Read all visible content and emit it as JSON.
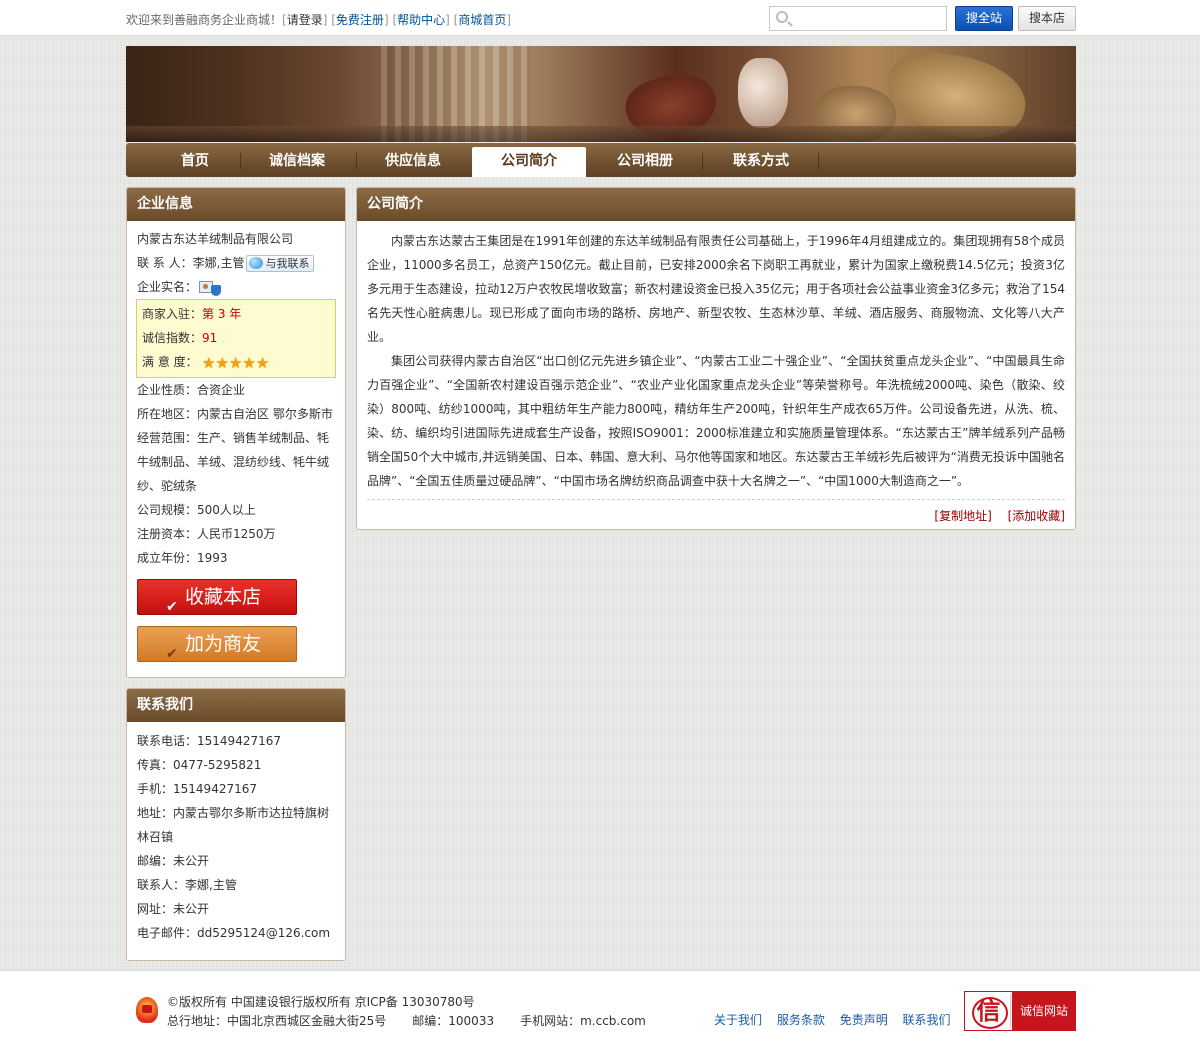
{
  "topbar": {
    "welcome": "欢迎来到善融商务企业商城！",
    "login": "请登录",
    "register": "免费注册",
    "help": "帮助中心",
    "mall_home": "商城首页",
    "search_placeholder": "",
    "search_site": "搜全站",
    "search_shop": "搜本店"
  },
  "nav": {
    "items": [
      "首页",
      "诚信档案",
      "供应信息",
      "公司简介",
      "公司相册",
      "联系方式"
    ],
    "active": "公司简介"
  },
  "enterprise": {
    "heading": "企业信息",
    "company_name": "内蒙古东达羊绒制品有限公司",
    "contact_label": "联 系 人：",
    "contact_person": "李娜,主管",
    "contact_me": "与我联系",
    "realname_label": "企业实名：",
    "credit": {
      "settled_label": "商家入驻：",
      "settled_value": "第 3 年",
      "index_label": "诚信指数：",
      "index_value": "91",
      "satisfaction_label": "满 意 度：",
      "satisfaction_stars": "★★★★★",
      "satisfaction_rating": 5
    },
    "nature_label": "企业性质：",
    "nature": "合资企业",
    "region_label": "所在地区：",
    "region": "内蒙古自治区 鄂尔多斯市",
    "scope_label": "经营范围：",
    "scope": "生产、销售羊绒制品、牦牛绒制品、羊绒、混纺纱线、牦牛绒纱、驼绒条",
    "scale_label": "公司规模：",
    "scale": "500人以上",
    "capital_label": "注册资本：",
    "capital": "人民币1250万",
    "founded_label": "成立年份：",
    "founded": "1993",
    "fav_button": "收藏本店",
    "friend_button": "加为商友"
  },
  "contact": {
    "heading": "联系我们",
    "phone_label": "联系电话：",
    "phone": "15149427167",
    "fax_label": "传真：",
    "fax": "0477-5295821",
    "mobile_label": "手机：",
    "mobile": "15149427167",
    "address_label": "地址：",
    "address": "内蒙古鄂尔多斯市达拉特旗树林召镇",
    "postcode_label": "邮编：",
    "postcode": "未公开",
    "person_label": "联系人：",
    "person": "李娜,主管",
    "website_label": "网址：",
    "website": "未公开",
    "email_label": "电子邮件：",
    "email": "dd5295124@126.com"
  },
  "intro": {
    "heading": "公司简介",
    "para1": "内蒙古东达蒙古王集团是在1991年创建的东达羊绒制品有限责任公司基础上，于1996年4月组建成立的。集团现拥有58个成员企业，11000多名员工，总资产150亿元。截止目前，已安排2000余名下岗职工再就业，累计为国家上缴税费14.5亿元；投资3亿多元用于生态建设，拉动12万户农牧民增收致富；新农村建设资金已投入35亿元；用于各项社会公益事业资金3亿多元；救治了154名先天性心脏病患儿。现已形成了面向市场的路桥、房地产、新型农牧、生态林沙草、羊绒、酒店服务、商服物流、文化等八大产业。",
    "para2": "集团公司获得内蒙古自治区“出口创亿元先进乡镇企业”、“内蒙古工业二十强企业”、“全国扶贫重点龙头企业”、“中国最具生命力百强企业”、“全国新农村建设百强示范企业”、“农业产业化国家重点龙头企业”等荣誉称号。年洗梳绒2000吨、染色（散染、绞染）800吨、纺纱1000吨，其中粗纺年生产能力800吨，精纺年生产200吨，针织年生产成衣65万件。公司设备先进，从洗、梳、染、纺、编织均引进国际先进成套生产设备，按照ISO9001：2000标准建立和实施质量管理体系。“东达蒙古王”牌羊绒系列产品畅销全国50个大中城市,并远销美国、日本、韩国、意大利、马尔他等国家和地区。东达蒙古王羊绒衫先后被评为“消费无投诉中国驰名品牌”、“全国五佳质量过硬品牌”、“中国市场名牌纺织商品调查中获十大名牌之一”、“中国1000大制造商之一”。",
    "copy_link": "[复制地址]",
    "add_fav": "[添加收藏]"
  },
  "footer": {
    "copyright": "©版权所有 中国建设银行版权所有 京ICP备 13030780号",
    "address": "总行地址：中国北京西城区金融大街25号",
    "postcode": "邮编：100033",
    "mobile_site": "手机网站：m.ccb.com",
    "links": [
      "关于我们",
      "服务条款",
      "免责声明",
      "联系我们"
    ],
    "badge_seal": "信",
    "badge_text": "诚信网站"
  },
  "colors": {
    "nav_brown": "#6e4f2e",
    "panel_head": "#7a5a38",
    "accent_red": "#c40000",
    "link_blue": "#1a5ba8",
    "search_blue": "#0d4fb2"
  }
}
